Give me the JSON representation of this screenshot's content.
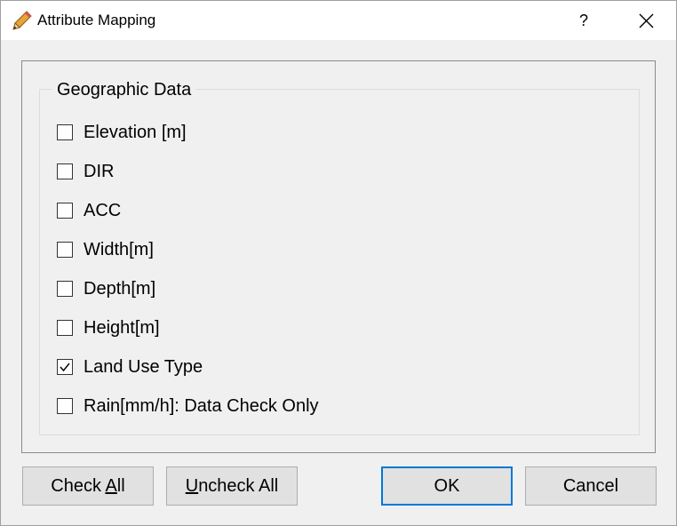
{
  "window": {
    "title": "Attribute Mapping",
    "help_label": "?",
    "icon": "pencil-icon"
  },
  "groupbox": {
    "title": "Geographic Data",
    "items": [
      {
        "label": "Elevation [m]",
        "checked": false
      },
      {
        "label": "DIR",
        "checked": false
      },
      {
        "label": "ACC",
        "checked": false
      },
      {
        "label": "Width[m]",
        "checked": false
      },
      {
        "label": "Depth[m]",
        "checked": false
      },
      {
        "label": "Height[m]",
        "checked": false
      },
      {
        "label": "Land Use Type",
        "checked": true
      },
      {
        "label": "Rain[mm/h]: Data Check Only",
        "checked": false
      }
    ]
  },
  "buttons": {
    "check_all": {
      "pre": "Check ",
      "mnemonic": "A",
      "post": "ll"
    },
    "uncheck_all": {
      "pre": "",
      "mnemonic": "U",
      "post": "ncheck All"
    },
    "ok": "OK",
    "cancel": "Cancel"
  },
  "colors": {
    "focus_border": "#0078d7",
    "button_face": "#e1e1e1",
    "dialog_bg": "#f0f0f0"
  }
}
